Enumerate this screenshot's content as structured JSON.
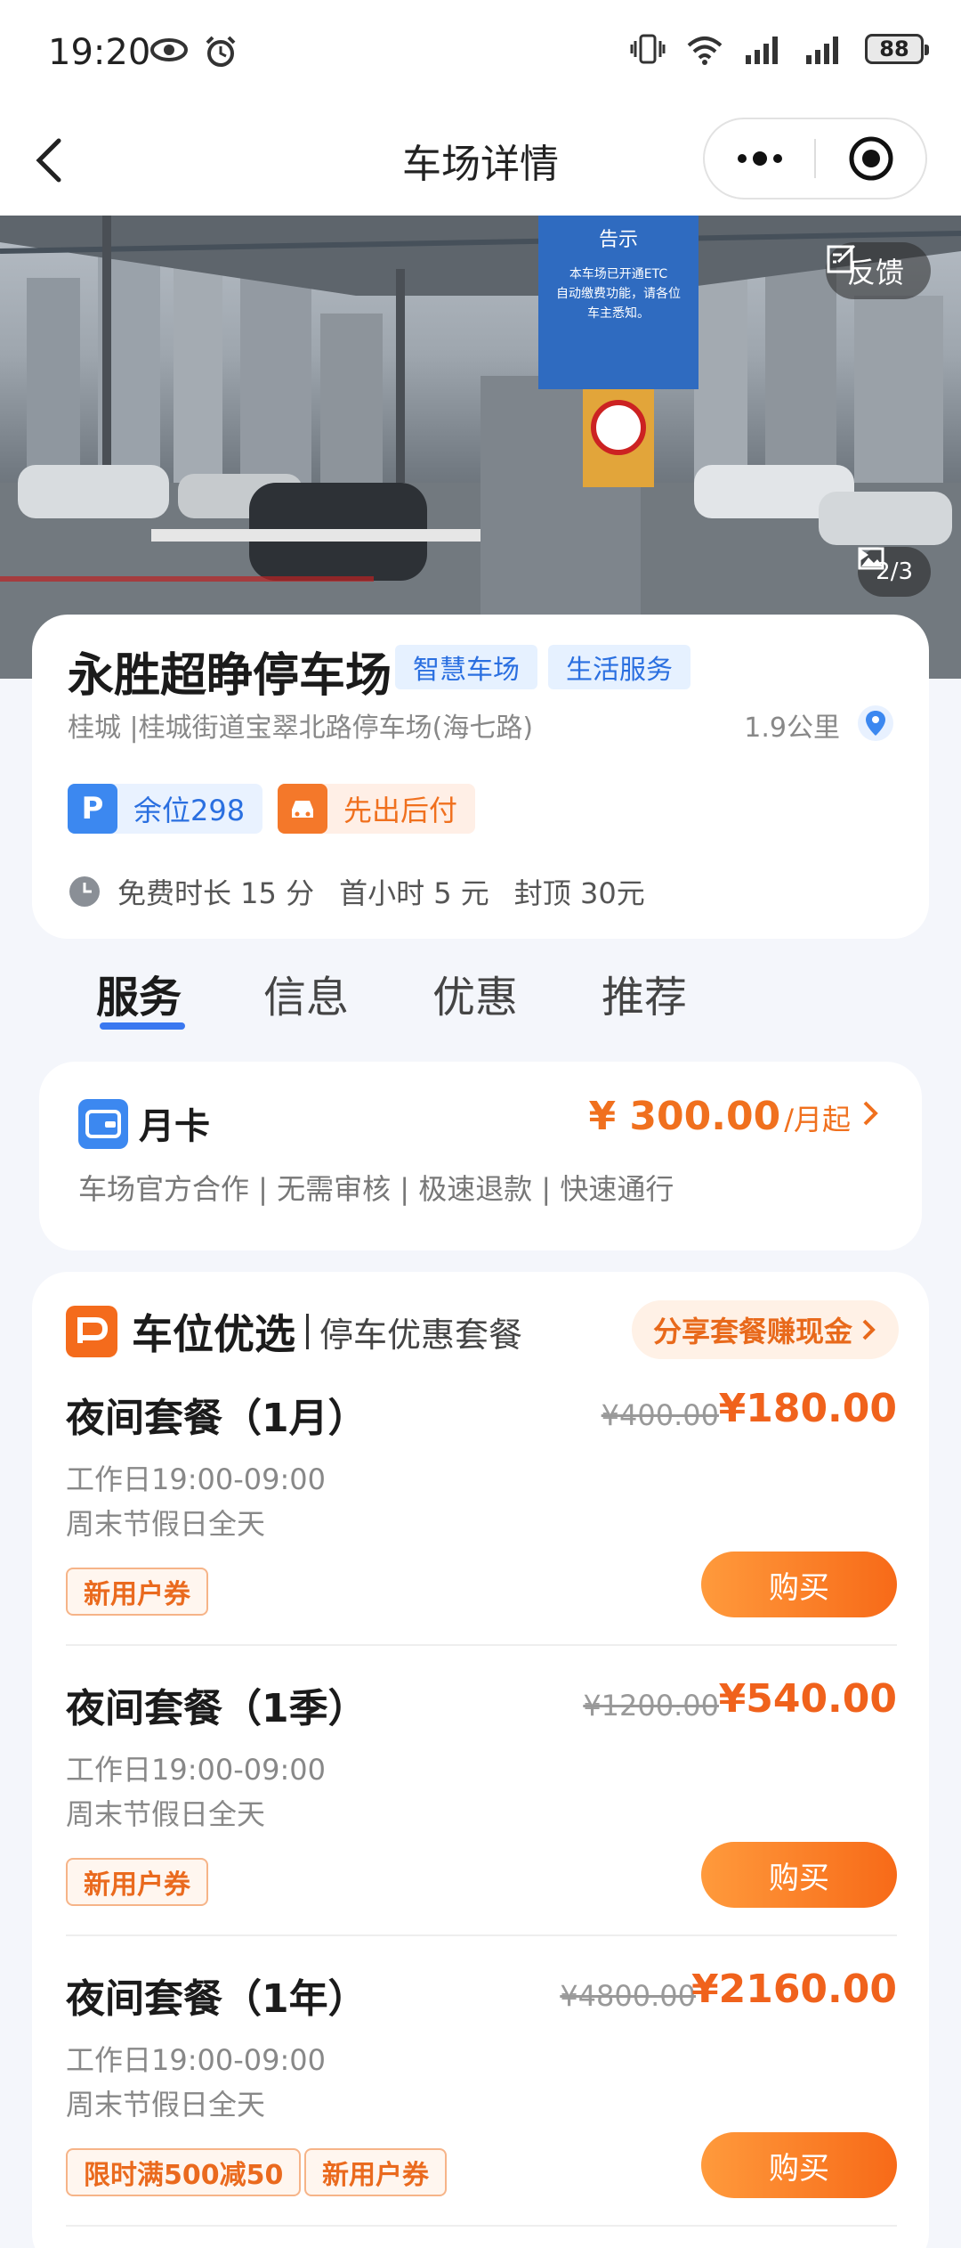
{
  "status_bar": {
    "time": "19:20",
    "battery": "88"
  },
  "nav": {
    "title": "车场详情"
  },
  "hero": {
    "feedback_label": "反馈",
    "photo_count": "2/3",
    "sign_title": "告示",
    "sign_text_1": "本车场已开通ETC",
    "sign_text_2": "自动缴费功能，请各位",
    "sign_text_3": "车主悉知。"
  },
  "lot": {
    "name": "永胜超睁停车场",
    "tags": [
      "智慧车场",
      "生活服务"
    ],
    "address": "桂城 |桂城街道宝翠北路停车场(海七路)",
    "distance": "1.9公里",
    "spaces_label": "余位298",
    "pay_label": "先出后付",
    "fees": [
      "免费时长 15 分",
      "首小时 5 元",
      "封顶 30元"
    ]
  },
  "tabs": [
    "服务",
    "信息",
    "优惠",
    "推荐"
  ],
  "monthly": {
    "title": "月卡",
    "price": "¥ 300.00",
    "unit": "/月起",
    "desc": "车场官方合作 | 无需审核 | 极速退款 | 快速通行"
  },
  "packages": {
    "title": "车位优选",
    "subtitle": "停车优惠套餐",
    "share_label": "分享套餐赚现金",
    "items": [
      {
        "name": "夜间套餐（1月）",
        "old_price": "¥400.00",
        "price": "¥180.00",
        "line1": "工作日19:00-09:00",
        "line2": "周末节假日全天",
        "coupons": [
          "新用户券"
        ],
        "buy": "购买"
      },
      {
        "name": "夜间套餐（1季）",
        "old_price": "¥1200.00",
        "price": "¥540.00",
        "line1": "工作日19:00-09:00",
        "line2": "周末节假日全天",
        "coupons": [
          "新用户券"
        ],
        "buy": "购买"
      },
      {
        "name": "夜间套餐（1年）",
        "old_price": "¥4800.00",
        "price": "¥2160.00",
        "line1": "工作日19:00-09:00",
        "line2": "周末节假日全天",
        "coupons": [
          "限时满500减50",
          "新用户券"
        ],
        "buy": "购买"
      }
    ]
  }
}
